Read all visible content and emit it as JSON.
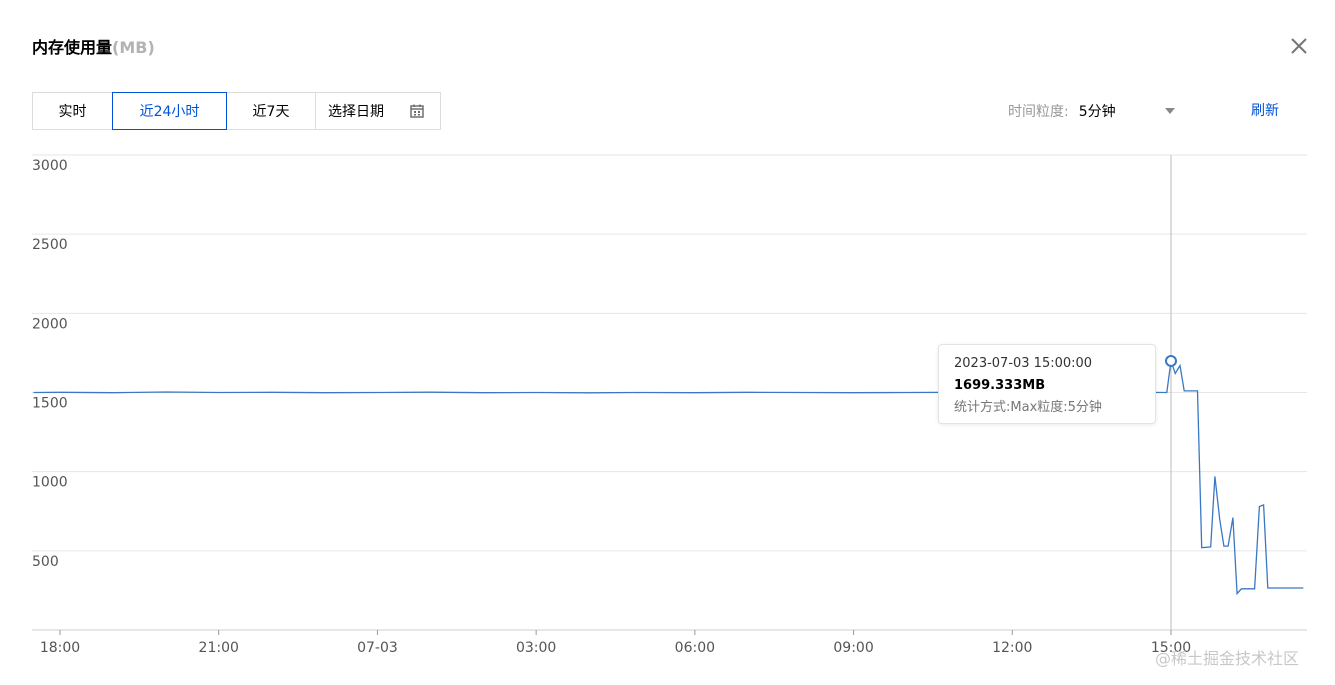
{
  "panel": {
    "title": "内存使用量",
    "unit": "(MB)"
  },
  "tabs": [
    {
      "label": "实时",
      "active": false
    },
    {
      "label": "近24小时",
      "active": true
    },
    {
      "label": "近7天",
      "active": false
    },
    {
      "label": "选择日期",
      "active": false,
      "icon": "calendar-icon"
    }
  ],
  "granularity": {
    "label": "时间粒度:",
    "value": "5分钟"
  },
  "refresh_label": "刷新",
  "tooltip": {
    "time": "2023-07-03 15:00:00",
    "value": "1699.333MB",
    "stat": "统计方式:Max粒度:5分钟"
  },
  "watermark": "@稀土掘金技术社区",
  "colors": {
    "accent": "#0052d9",
    "line": "#3a78c3"
  },
  "chart_data": {
    "type": "line",
    "ylim": [
      0,
      3000
    ],
    "yticks": [
      "3000",
      "2500",
      "2000",
      "1500",
      "1000",
      "500"
    ],
    "xticks": [
      "18:00",
      "21:00",
      "07-03",
      "03:00",
      "06:00",
      "09:00",
      "12:00",
      "15:00"
    ],
    "xtick_hours": [
      18,
      21,
      24,
      27,
      30,
      33,
      36,
      39
    ],
    "x_start_hour": 17.5,
    "x_end_hour": 41.5,
    "grid": true,
    "highlight": {
      "hour": 39,
      "value": 1699.333
    },
    "series": [
      {
        "values": [
          [
            17.5,
            1500
          ],
          [
            18,
            1501
          ],
          [
            19,
            1499
          ],
          [
            20,
            1503
          ],
          [
            21,
            1500
          ],
          [
            22,
            1501
          ],
          [
            23,
            1499
          ],
          [
            24,
            1500
          ],
          [
            25,
            1502
          ],
          [
            26,
            1499
          ],
          [
            27,
            1500
          ],
          [
            28,
            1498
          ],
          [
            29,
            1500
          ],
          [
            30,
            1499
          ],
          [
            31,
            1501
          ],
          [
            32,
            1500
          ],
          [
            33,
            1499
          ],
          [
            34,
            1500
          ],
          [
            35,
            1501
          ],
          [
            36,
            1500
          ],
          [
            37,
            1500
          ],
          [
            38,
            1501
          ],
          [
            38.92,
            1500
          ],
          [
            39,
            1699.333
          ],
          [
            39.08,
            1620
          ],
          [
            39.17,
            1670
          ],
          [
            39.25,
            1510
          ],
          [
            39.5,
            1510
          ],
          [
            39.58,
            520
          ],
          [
            39.75,
            525
          ],
          [
            39.83,
            970
          ],
          [
            39.92,
            700
          ],
          [
            40.0,
            530
          ],
          [
            40.08,
            530
          ],
          [
            40.17,
            710
          ],
          [
            40.25,
            230
          ],
          [
            40.33,
            260
          ],
          [
            40.58,
            260
          ],
          [
            40.67,
            780
          ],
          [
            40.75,
            790
          ],
          [
            40.83,
            265
          ],
          [
            41.5,
            265
          ]
        ]
      }
    ]
  }
}
